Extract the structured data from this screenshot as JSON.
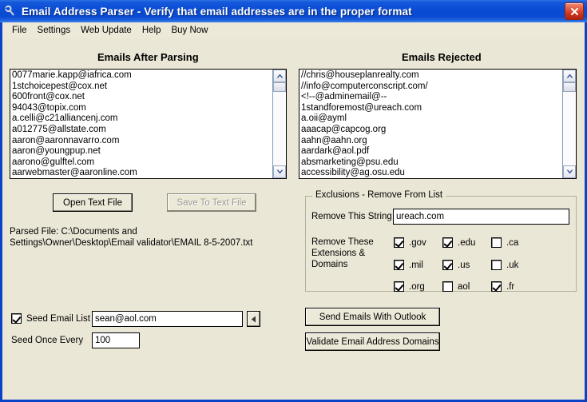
{
  "window": {
    "title": "Email Address Parser - Verify that email addresses are in the proper format",
    "icon": "wrench-icon",
    "close_label": "✕",
    "titlebar_color": "#0a4bd4",
    "background_color": "#eae7d6",
    "close_button_color": "#c8301a"
  },
  "menu": {
    "items": [
      {
        "label": "File"
      },
      {
        "label": "Settings"
      },
      {
        "label": "Web Update"
      },
      {
        "label": "Help"
      },
      {
        "label": "Buy Now"
      }
    ]
  },
  "parsed_panel": {
    "heading": "Emails After Parsing",
    "emails": [
      "0077marie.kapp@iafrica.com",
      "1stchoicepest@cox.net",
      "600front@cox.net",
      "94043@topix.com",
      "a.celli@c21alliancenj.com",
      "a012775@allstate.com",
      "aaron@aaronnavarro.com",
      "aaron@youngpup.net",
      "aarono@gulftel.com",
      "aarwebmaster@aaronline.com"
    ]
  },
  "rejected_panel": {
    "heading": "Emails Rejected",
    "emails": [
      "//chris@houseplanrealty.com",
      "//info@computerconscript.com/",
      "<!--@adminemail@--",
      "1standforemost@ureach.com",
      "a.oii@ayml",
      "aaacap@capcog.org",
      "aahn@aahn.org",
      "aardark@aol.pdf",
      "absmarketing@psu.edu",
      "accessibility@ag.osu.edu"
    ]
  },
  "file_actions": {
    "open_label": "Open Text File",
    "save_label": "Save To Text File",
    "save_disabled": true,
    "parsed_file_text": "Parsed File: C:\\Documents and Settings\\Owner\\Desktop\\Email validator\\EMAIL 8-5-2007.txt"
  },
  "exclusions": {
    "group_title": "Exclusions - Remove From List",
    "remove_string_label": "Remove This String",
    "remove_string_value": "ureach.com",
    "remove_string_placeholder": "",
    "extensions_label_line1": "Remove These",
    "extensions_label_line2": "Extensions &",
    "extensions_label_line3": "Domains",
    "checkboxes": [
      {
        "label": ".gov",
        "checked": true,
        "col": 0,
        "row": 0
      },
      {
        "label": ".edu",
        "checked": true,
        "col": 1,
        "row": 0
      },
      {
        "label": ".ca",
        "checked": false,
        "col": 2,
        "row": 0
      },
      {
        "label": ".mil",
        "checked": true,
        "col": 0,
        "row": 1
      },
      {
        "label": ".us",
        "checked": true,
        "col": 1,
        "row": 1
      },
      {
        "label": ".uk",
        "checked": false,
        "col": 2,
        "row": 1
      },
      {
        "label": ".org",
        "checked": true,
        "col": 0,
        "row": 2
      },
      {
        "label": "aol",
        "checked": false,
        "col": 1,
        "row": 2
      },
      {
        "label": ".fr",
        "checked": true,
        "col": 2,
        "row": 2
      }
    ]
  },
  "seed": {
    "seed_email_list_label": "Seed Email List",
    "seed_email_list_checked": true,
    "seed_email_value": "sean@aol.com",
    "seed_email_placeholder": "",
    "seed_once_every_label": "Seed Once Every",
    "seed_once_every_value": "100",
    "spin_icon": "triangle-left-icon"
  },
  "actions": {
    "send_outlook_label": "Send Emails With Outlook",
    "validate_domains_label": "Validate Email Address Domains"
  }
}
